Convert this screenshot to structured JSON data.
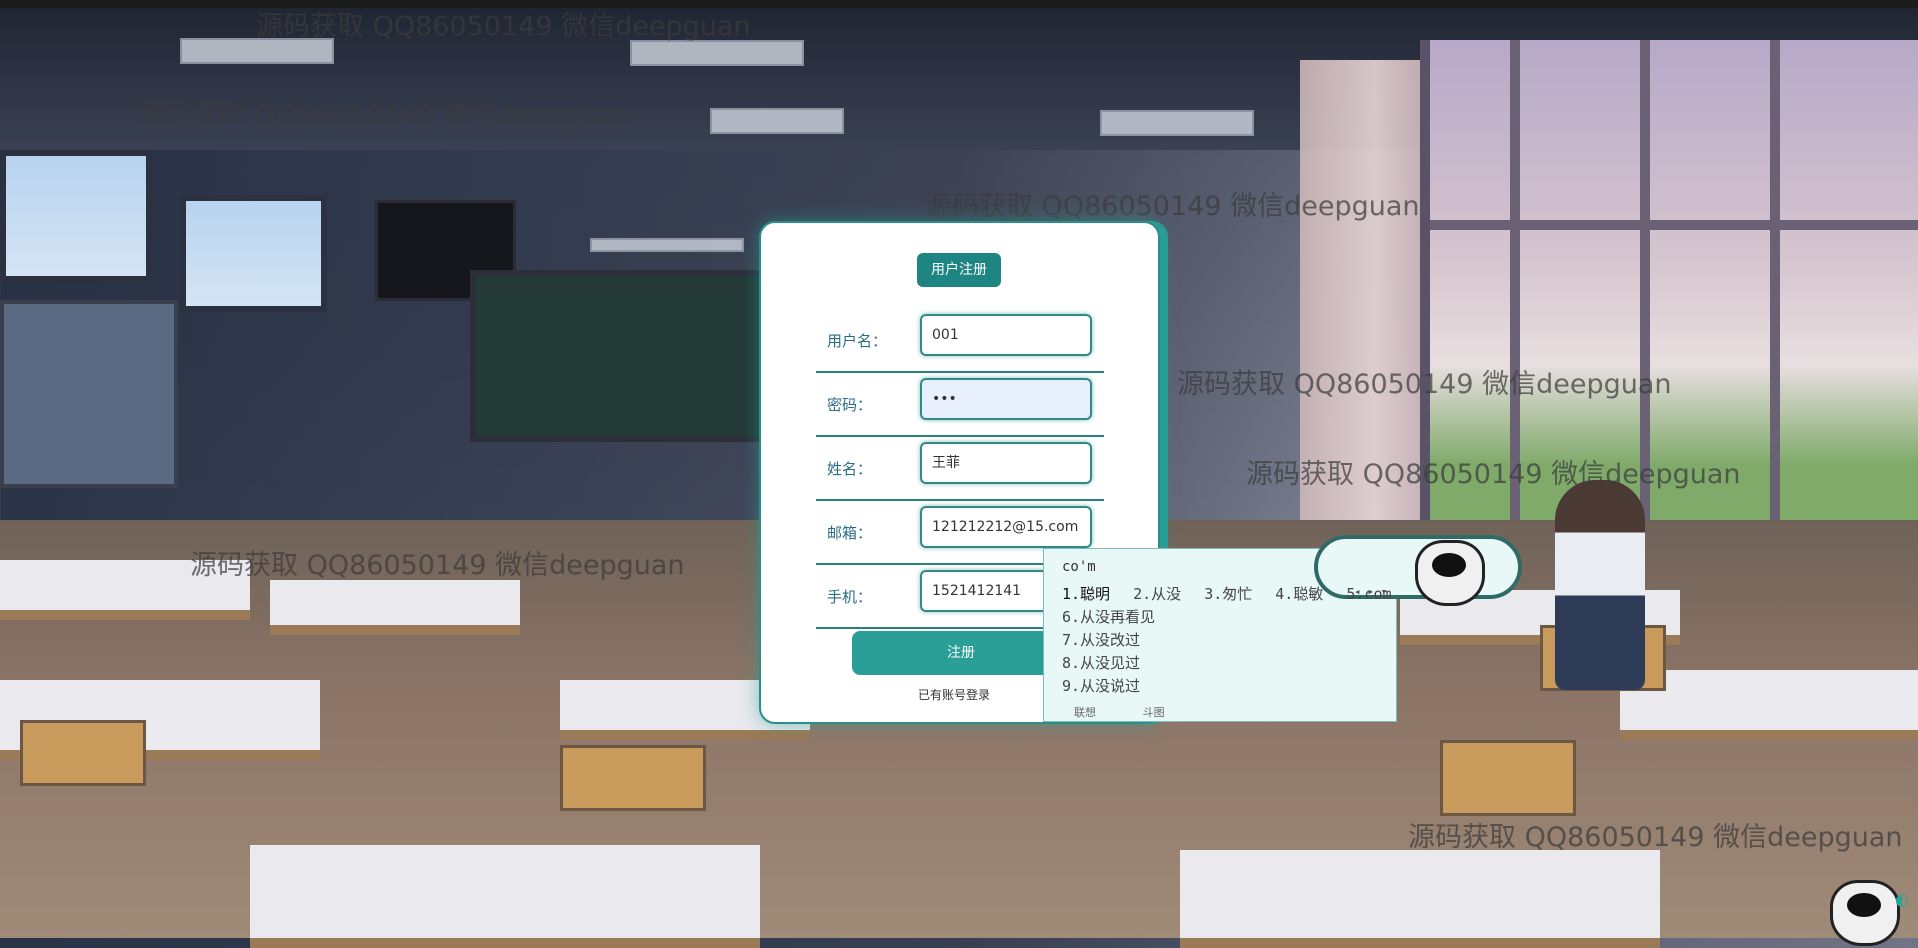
{
  "watermark": "源码获取 QQ86050149 微信deepguan",
  "form": {
    "title": "用户注册",
    "fields": [
      {
        "label": "用户名：",
        "value": "001"
      },
      {
        "label": "密码：",
        "value": "•••"
      },
      {
        "label": "姓名：",
        "value": "王菲"
      },
      {
        "label": "邮箱：",
        "value": "121212212@15.com"
      },
      {
        "label": "手机：",
        "value": "1521412141"
      }
    ],
    "submit_label": "注册",
    "login_link": "已有账号登录"
  },
  "ime": {
    "composition": "co'm",
    "candidates": [
      "1.聪明",
      "2.从没",
      "3.匆忙",
      "4.聪敏",
      "5.com"
    ],
    "more_candidates": [
      "6.从没再看见",
      "7.从没改过",
      "8.从没见过",
      "9.从没说过"
    ],
    "footer": [
      "联想",
      "斗图"
    ]
  },
  "colors": {
    "accent": "#2a9f98",
    "title_bg": "#1f8583",
    "label": "#2a6b85"
  }
}
